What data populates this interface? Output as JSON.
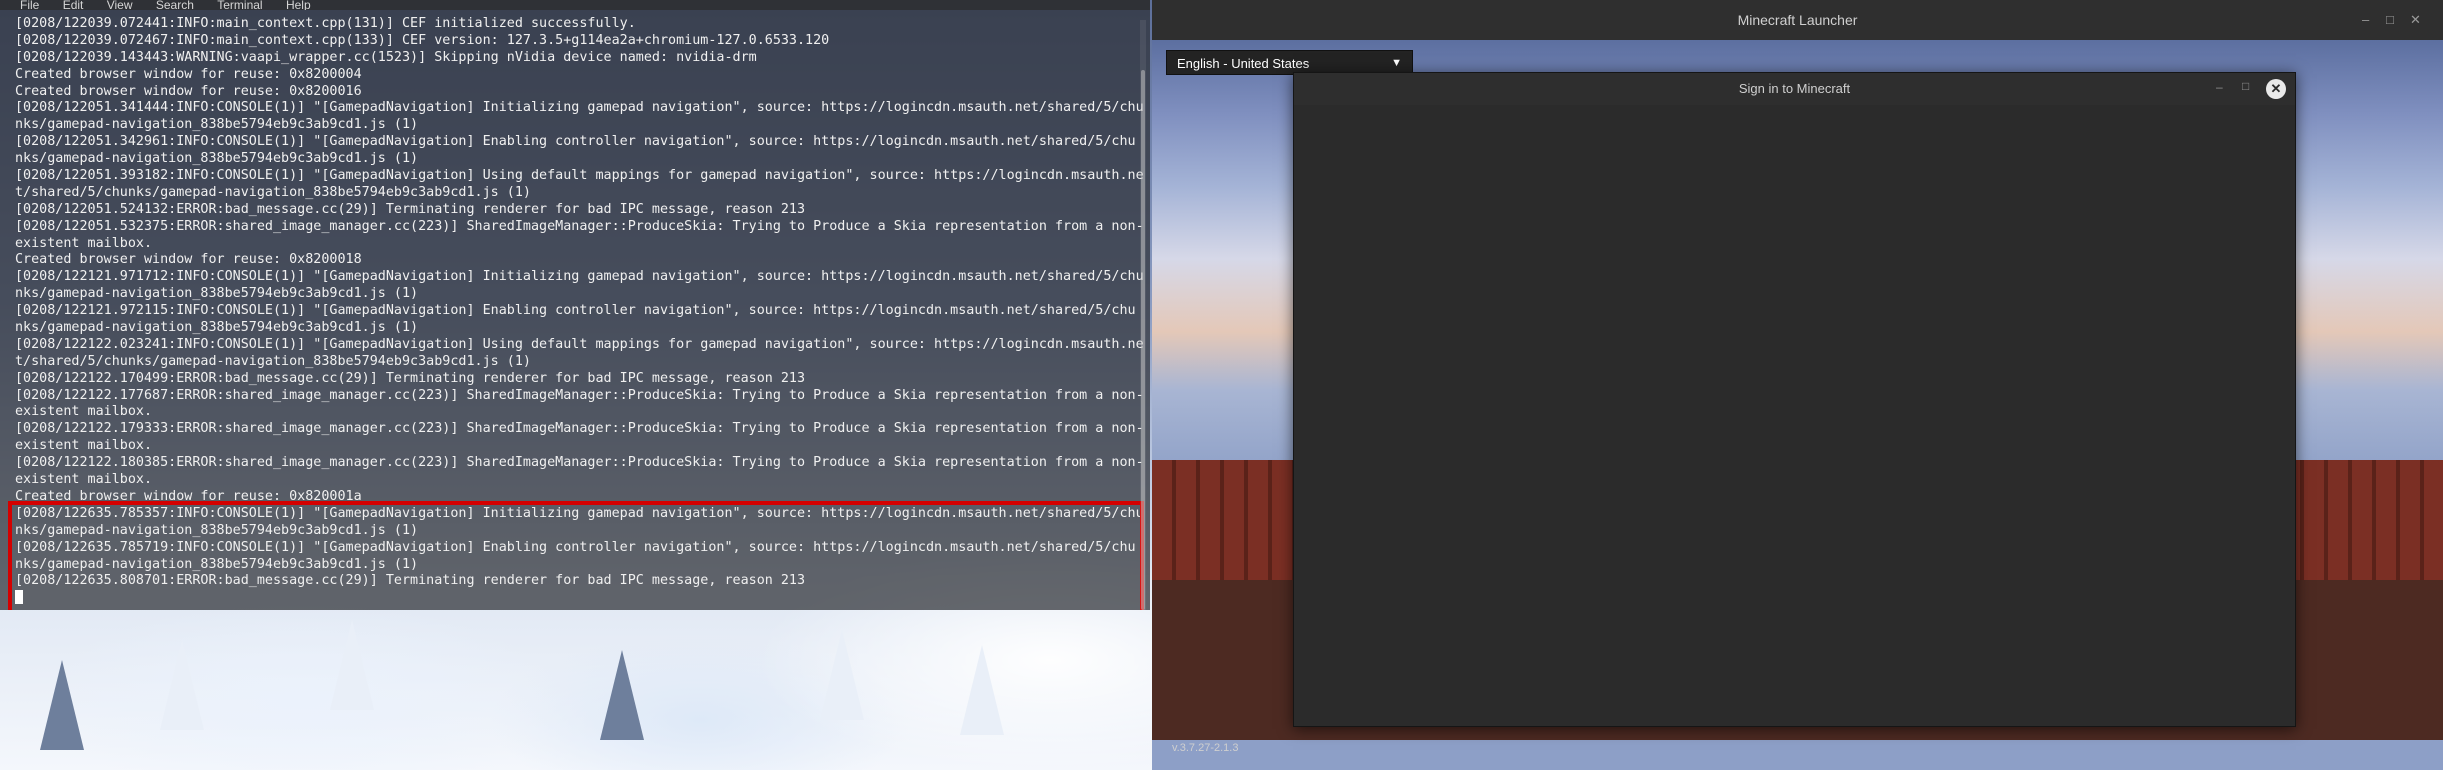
{
  "terminal": {
    "menu": [
      "File",
      "Edit",
      "View",
      "Search",
      "Terminal",
      "Help"
    ],
    "lines": [
      "[0208/122039.072441:INFO:main_context.cpp(131)] CEF initialized successfully.",
      "[0208/122039.072467:INFO:main_context.cpp(133)] CEF version: 127.3.5+g114ea2a+chromium-127.0.6533.120",
      "[0208/122039.143443:WARNING:vaapi_wrapper.cc(1523)] Skipping nVidia device named: nvidia-drm",
      "Created browser window for reuse: 0x8200004",
      "Created browser window for reuse: 0x8200016",
      "[0208/122051.341444:INFO:CONSOLE(1)] \"[GamepadNavigation] Initializing gamepad navigation\", source: https://logincdn.msauth.net/shared/5/chu",
      "nks/gamepad-navigation_838be5794eb9c3ab9cd1.js (1)",
      "[0208/122051.342961:INFO:CONSOLE(1)] \"[GamepadNavigation] Enabling controller navigation\", source: https://logincdn.msauth.net/shared/5/chu",
      "nks/gamepad-navigation_838be5794eb9c3ab9cd1.js (1)",
      "[0208/122051.393182:INFO:CONSOLE(1)] \"[GamepadNavigation] Using default mappings for gamepad navigation\", source: https://logincdn.msauth.ne",
      "t/shared/5/chunks/gamepad-navigation_838be5794eb9c3ab9cd1.js (1)",
      "[0208/122051.524132:ERROR:bad_message.cc(29)] Terminating renderer for bad IPC message, reason 213",
      "[0208/122051.532375:ERROR:shared_image_manager.cc(223)] SharedImageManager::ProduceSkia: Trying to Produce a Skia representation from a non-",
      "existent mailbox.",
      "Created browser window for reuse: 0x8200018",
      "[0208/122121.971712:INFO:CONSOLE(1)] \"[GamepadNavigation] Initializing gamepad navigation\", source: https://logincdn.msauth.net/shared/5/chu",
      "nks/gamepad-navigation_838be5794eb9c3ab9cd1.js (1)",
      "[0208/122121.972115:INFO:CONSOLE(1)] \"[GamepadNavigation] Enabling controller navigation\", source: https://logincdn.msauth.net/shared/5/chu",
      "nks/gamepad-navigation_838be5794eb9c3ab9cd1.js (1)",
      "[0208/122122.023241:INFO:CONSOLE(1)] \"[GamepadNavigation] Using default mappings for gamepad navigation\", source: https://logincdn.msauth.ne",
      "t/shared/5/chunks/gamepad-navigation_838be5794eb9c3ab9cd1.js (1)",
      "[0208/122122.170499:ERROR:bad_message.cc(29)] Terminating renderer for bad IPC message, reason 213",
      "[0208/122122.177687:ERROR:shared_image_manager.cc(223)] SharedImageManager::ProduceSkia: Trying to Produce a Skia representation from a non-",
      "existent mailbox.",
      "[0208/122122.179333:ERROR:shared_image_manager.cc(223)] SharedImageManager::ProduceSkia: Trying to Produce a Skia representation from a non-",
      "existent mailbox.",
      "[0208/122122.180385:ERROR:shared_image_manager.cc(223)] SharedImageManager::ProduceSkia: Trying to Produce a Skia representation from a non-",
      "existent mailbox.",
      "Created browser window for reuse: 0x820001a",
      "[0208/122635.785357:INFO:CONSOLE(1)] \"[GamepadNavigation] Initializing gamepad navigation\", source: https://logincdn.msauth.net/shared/5/chu",
      "nks/gamepad-navigation_838be5794eb9c3ab9cd1.js (1)",
      "[0208/122635.785719:INFO:CONSOLE(1)] \"[GamepadNavigation] Enabling controller navigation\", source: https://logincdn.msauth.net/shared/5/chu",
      "nks/gamepad-navigation_838be5794eb9c3ab9cd1.js (1)",
      "[0208/122635.808701:ERROR:bad_message.cc(29)] Terminating renderer for bad IPC message, reason 213"
    ],
    "highlight_color": "#d40000"
  },
  "launcher": {
    "title": "Minecraft Launcher",
    "language": "English - United States",
    "version": "v.3.7.27-2.1.3"
  },
  "dialog": {
    "title": "Sign in to Minecraft",
    "close_icon": "close-icon"
  }
}
